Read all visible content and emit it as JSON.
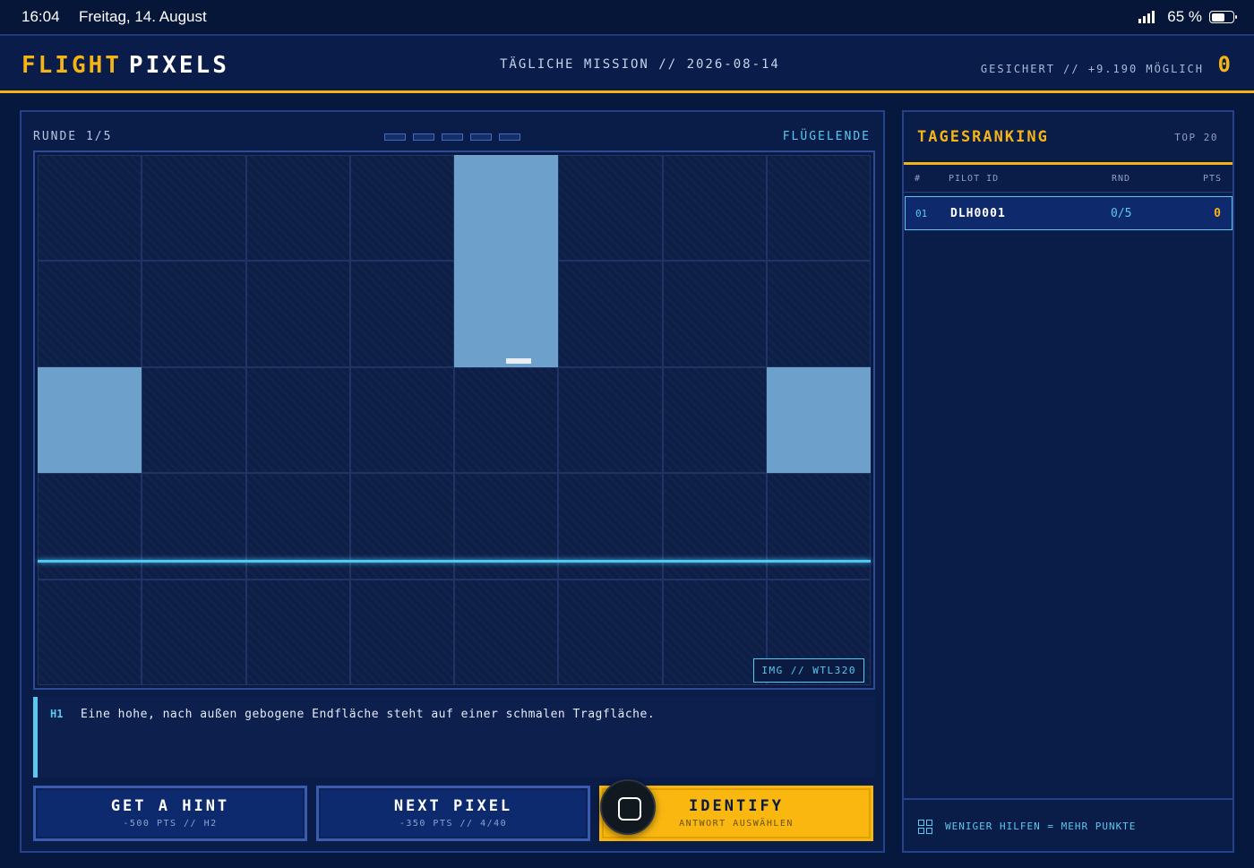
{
  "status_bar": {
    "time": "16:04",
    "date": "Freitag, 14. August",
    "battery": "65 %",
    "battery_level": 0.65
  },
  "header": {
    "logo_part1": "FLIGHT",
    "logo_part2": "PIXELS",
    "mission": "TÄGLICHE MISSION // 2026-08-14",
    "score_info": "GESICHERT // +9.190 MÖGLICH",
    "score": "0"
  },
  "game": {
    "round": "RUNDE 1/5",
    "round_progress": 0,
    "round_total": 5,
    "category": "FLÜGELENDE",
    "image_tag": "IMG // WTL320",
    "grid_columns": 8,
    "grid_rows": 5,
    "revealed_cells": [
      [
        0,
        4
      ],
      [
        1,
        4
      ],
      [
        2,
        0
      ],
      [
        2,
        7
      ]
    ],
    "hint": {
      "id": "H1",
      "text": "Eine hohe, nach außen gebogene Endfläche steht auf einer schmalen Tragfläche."
    }
  },
  "actions": {
    "hint": {
      "title": "GET A HINT",
      "sub": "-500 PTS // H2"
    },
    "next": {
      "title": "NEXT PIXEL",
      "sub": "-350 PTS // 4/40"
    },
    "identify": {
      "title": "IDENTIFY",
      "sub": "ANTWORT AUSWÄHLEN"
    }
  },
  "ranking": {
    "title": "TAGESRANKING",
    "top": "TOP 20",
    "columns": {
      "rank": "#",
      "pilot": "PILOT ID",
      "round": "RND",
      "points": "PTS"
    },
    "rows": [
      {
        "rank": "01",
        "pilot": "DLH0001",
        "round": "0/5",
        "points": "0"
      }
    ],
    "footer": "WENIGER HILFEN = MEHR PUNKTE"
  },
  "colors": {
    "accent": "#f5b416",
    "cyan": "#5ac8f0",
    "background": "#07183f",
    "revealed": "#6ea0cc"
  }
}
